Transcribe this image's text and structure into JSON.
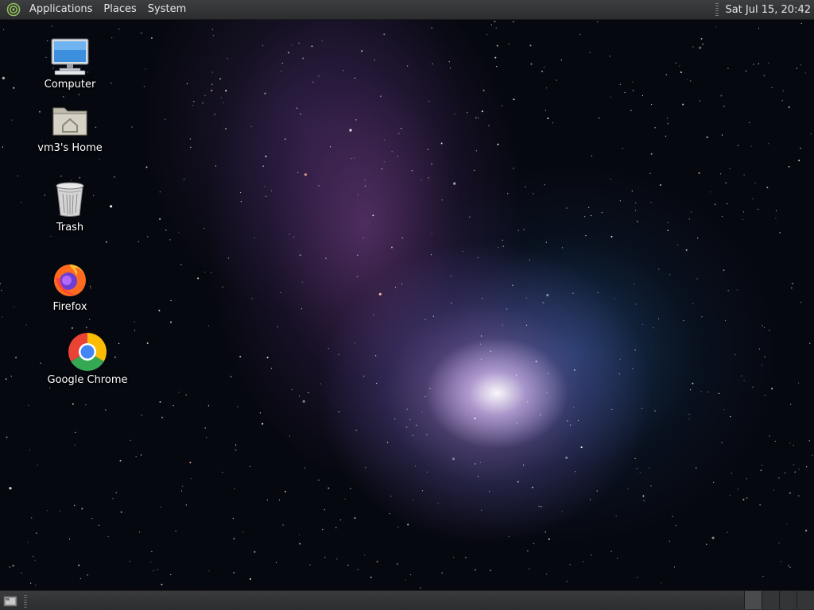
{
  "top_panel": {
    "menus": [
      "Applications",
      "Places",
      "System"
    ],
    "clock": "Sat Jul 15, 20:42"
  },
  "desktop": {
    "icons": [
      {
        "label": "Computer",
        "icon": "computer-icon"
      },
      {
        "label": "vm3's Home",
        "icon": "home-folder-icon"
      },
      {
        "label": "Trash",
        "icon": "trash-icon"
      },
      {
        "label": "Firefox",
        "icon": "firefox-icon"
      },
      {
        "label": "Google Chrome",
        "icon": "chrome-icon"
      }
    ]
  },
  "bottom_panel": {
    "show_desktop_icon": "show-desktop-icon",
    "workspace_count": 4,
    "active_workspace": 1
  },
  "colors": {
    "panel": "#2f3032",
    "panel_text": "#e6e6e6",
    "wallpaper_base": "#06080f",
    "nebula_purple": "#a987d8",
    "nebula_blue": "#2c5a96"
  }
}
